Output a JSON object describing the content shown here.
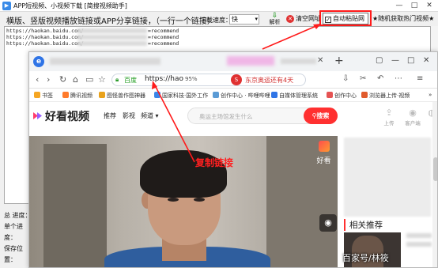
{
  "app": {
    "title": "APP短视频、小视频下载 [简搜视频助手]",
    "instruction": "横版、竖版视频播放链接或APP分享链接，（一行一个链接）",
    "speed_label": "下载速度：",
    "speed_value": "快",
    "parse_label": "解析",
    "clear_label": "清空网址",
    "auto_paste_label": "自动粘贴网址",
    "hot_label": "★随机获取热门视频★",
    "links": [
      {
        "left": "https://haokan.baidu.com/",
        "right": "=recommend"
      },
      {
        "left": "https://haokan.baidu.com/",
        "right": "=recommend"
      },
      {
        "left": "https://haokan.baidu.com/",
        "right": "=recommend"
      }
    ],
    "status": {
      "total_progress": "总 进度：",
      "single_progress": "单个进度：",
      "save_location": "保存位置："
    },
    "win_controls": [
      "—",
      "□",
      "✕"
    ]
  },
  "browser": {
    "logo": "e",
    "new_tab": "+",
    "controls": [
      "▢",
      "—",
      "□",
      "✕"
    ],
    "nav_icons": [
      "‹",
      "›",
      "↻",
      "⌂",
      "▭",
      "☆"
    ],
    "address": {
      "site_name": "百度",
      "url": "https://hao",
      "zoom": "95%",
      "news": "东京奥运还有4天"
    },
    "nav_right_icons": [
      "⇩",
      "✂",
      "↶",
      "⋯",
      "≡"
    ],
    "bookmarks": [
      {
        "label": "书签",
        "color": "#f5a623"
      },
      {
        "label": "腾讯视频",
        "color": "#ff7b2b"
      },
      {
        "label": "图怪兽作图神器",
        "color": "#e9a21b"
      },
      {
        "label": "国家科技·国外工作",
        "color": "#3b86e8"
      },
      {
        "label": "创作中心 · 哔哩哔哩",
        "color": "#5b9bd5"
      },
      {
        "label": "自媒体管理系统",
        "color": "#2f74e6"
      },
      {
        "label": "创作中心",
        "color": "#e55353"
      },
      {
        "label": "浏览器上传·视频",
        "color": "#e05a2c"
      },
      {
        "label": "»",
        "color": ""
      }
    ]
  },
  "site": {
    "logo_text": "好看视频",
    "nav": [
      "推荐",
      "影视",
      "频道 ▾"
    ],
    "search_placeholder": "奥运主场馆发生什么",
    "search_button": "搜索",
    "header_icons": [
      {
        "glyph": "⇪",
        "label": "上传"
      },
      {
        "glyph": "◉",
        "label": "客户端"
      },
      {
        "glyph": "◍",
        "label": ""
      }
    ],
    "video_logo": "好看",
    "camera_icon": "📷",
    "related_title": "相关推荐",
    "watermark": "百家号/林筱"
  },
  "annotation": {
    "copy_link_label": "复制链接",
    "color": "#ff1a1a"
  }
}
